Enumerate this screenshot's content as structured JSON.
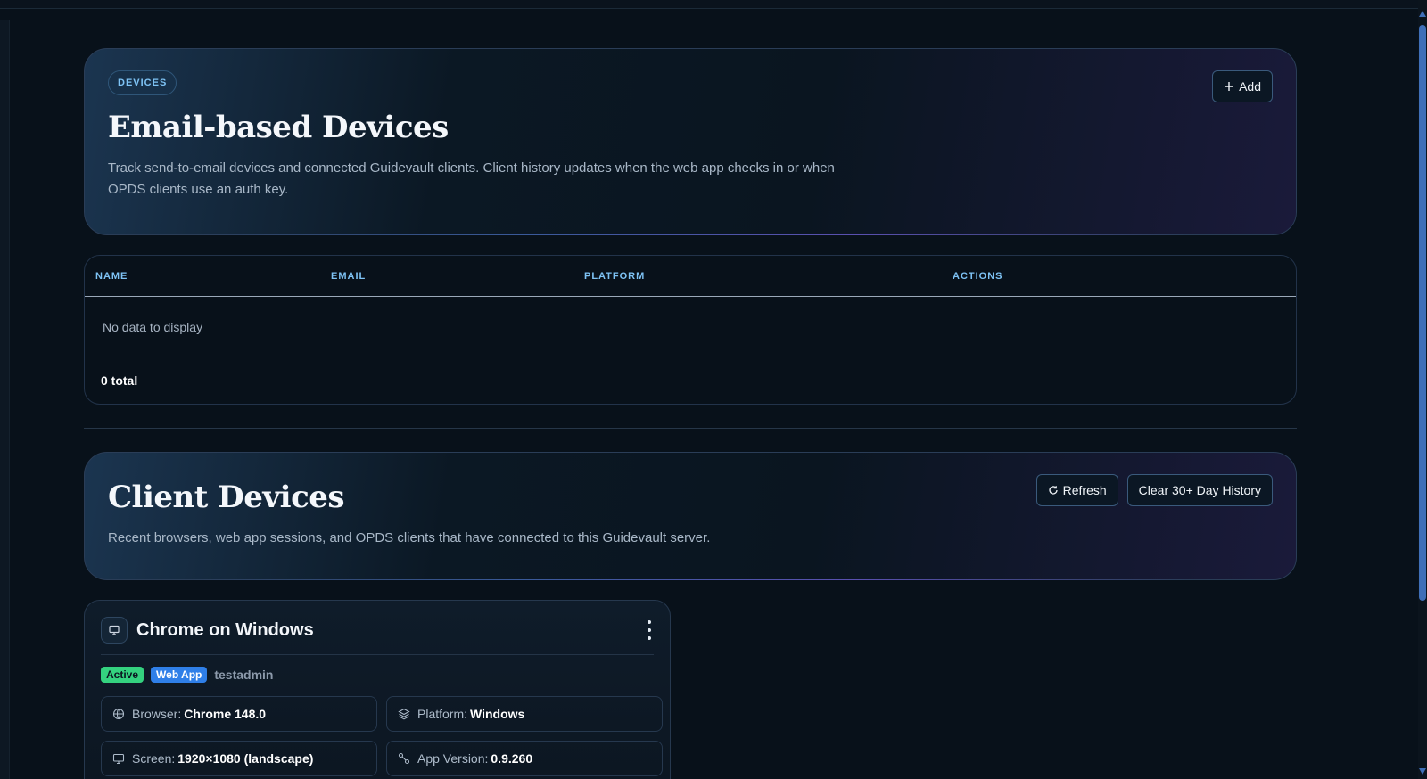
{
  "devices_section": {
    "badge": "DEVICES",
    "title": "Email-based Devices",
    "description": "Track send-to-email devices and connected Guidevault clients. Client history updates when the web app checks in or when OPDS clients use an auth key.",
    "add_label": "Add",
    "add_icon": "plus-icon"
  },
  "devices_table": {
    "columns": [
      "NAME",
      "EMAIL",
      "PLATFORM",
      "ACTIONS"
    ],
    "empty_text": "No data to display",
    "footer": "0 total"
  },
  "clients_section": {
    "title": "Client Devices",
    "description": "Recent browsers, web app sessions, and OPDS clients that have connected to this Guidevault server.",
    "refresh_label": "Refresh",
    "refresh_icon": "refresh-icon",
    "clear_label": "Clear 30+ Day History"
  },
  "client_card": {
    "icon": "monitor-icon",
    "title": "Chrome on Windows",
    "tags": {
      "status": "Active",
      "type": "Web App",
      "user": "testadmin"
    },
    "info": [
      {
        "icon": "globe-icon",
        "label": "Browser:",
        "value": "Chrome 148.0"
      },
      {
        "icon": "layers-icon",
        "label": "Platform:",
        "value": "Windows"
      },
      {
        "icon": "monitor-icon",
        "label": "Screen:",
        "value": "1920×1080 (landscape)"
      },
      {
        "icon": "version-icon",
        "label": "App Version:",
        "value": "0.9.260"
      }
    ]
  },
  "colors": {
    "background": "#08111a",
    "accent": "#7ec3f5",
    "active": "#34d27f",
    "web_app": "#2f7fe8",
    "scrollbar": "#3f6fb8"
  }
}
